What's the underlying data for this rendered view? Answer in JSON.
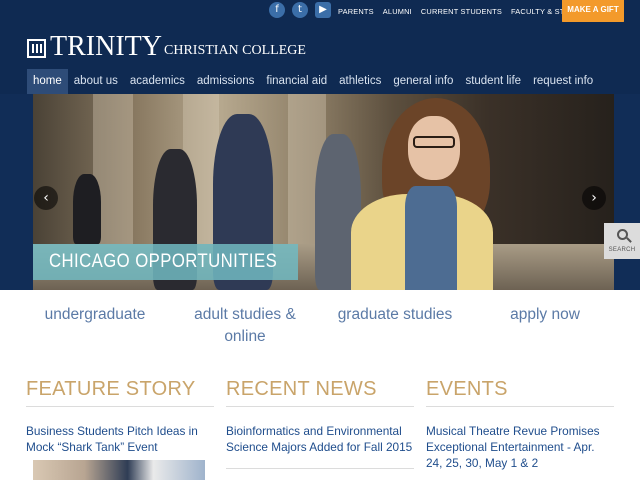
{
  "top_bar": {
    "social": [
      {
        "name": "facebook",
        "glyph": "f"
      },
      {
        "name": "twitter",
        "glyph": "t"
      },
      {
        "name": "youtube",
        "glyph": "▶"
      }
    ],
    "links": [
      "PARENTS",
      "ALUMNI",
      "CURRENT STUDENTS",
      "FACULTY & STAFF"
    ],
    "gift_label": "MAKE A GIFT"
  },
  "logo": {
    "name": "TRINITY",
    "subname": "CHRISTIAN COLLEGE"
  },
  "nav": {
    "items": [
      "home",
      "about us",
      "academics",
      "admissions",
      "financial aid",
      "athletics",
      "general info",
      "student life",
      "request info"
    ],
    "active": "home"
  },
  "hero": {
    "banner_text": "CHICAGO OPPORTUNITIES",
    "search_label": "SEARCH"
  },
  "quick_links": [
    "undergraduate",
    "adult studies & online",
    "graduate studies",
    "apply now"
  ],
  "columns": [
    {
      "title": "FEATURE STORY",
      "link": "Business Students Pitch Ideas in Mock “Shark Tank” Event"
    },
    {
      "title": "RECENT NEWS",
      "link": "Bioinformatics and Environmental Science Majors Added for Fall 2015"
    },
    {
      "title": "EVENTS",
      "link": "Musical Theatre Revue Promises Exceptional Entertainment - Apr. 24, 25, 30, May 1 & 2"
    }
  ],
  "colors": {
    "navy": "#0f2a52",
    "accent_gold": "#c9a46a",
    "gift_orange": "#f39a2b",
    "link_blue": "#1f4d8c"
  }
}
